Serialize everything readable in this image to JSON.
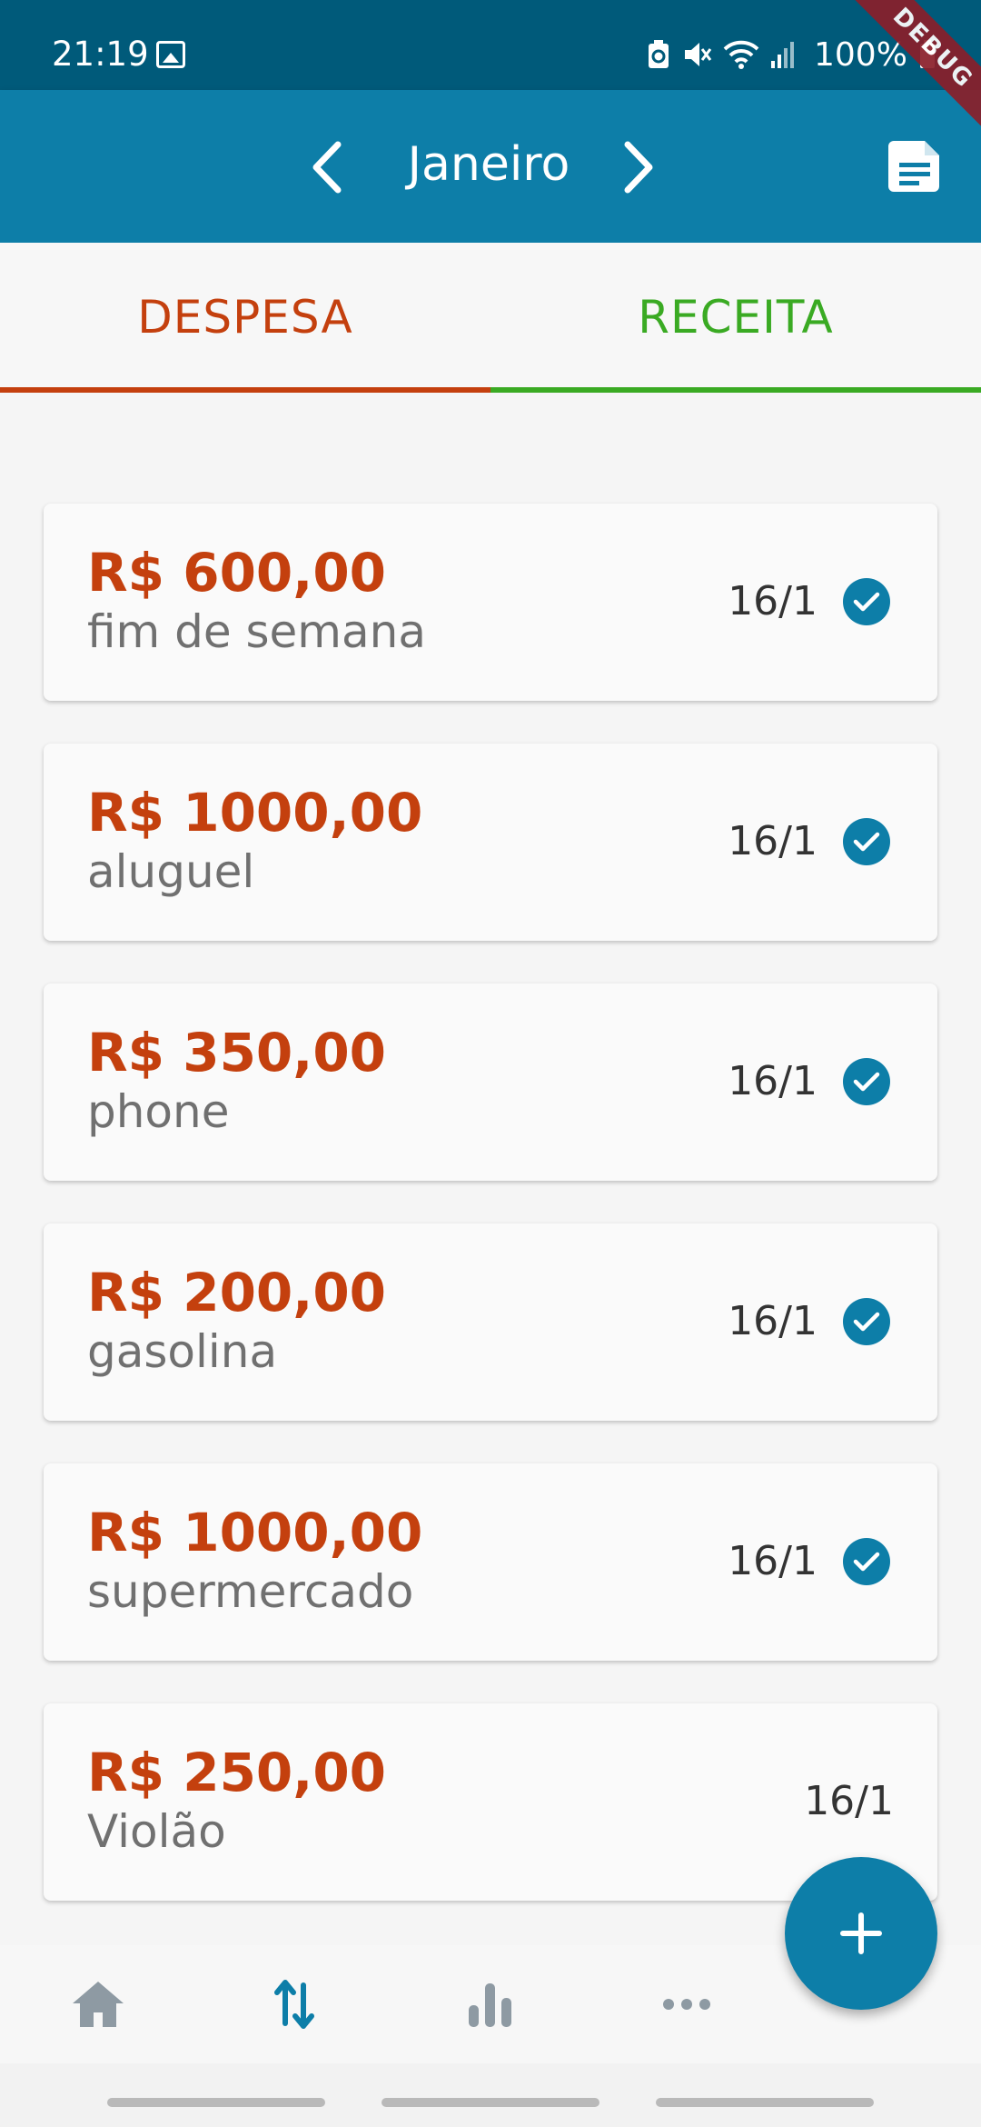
{
  "status_bar": {
    "time": "21:19",
    "battery_percent": "100%",
    "icons": [
      "gallery-icon",
      "battery-saver-icon",
      "mute-icon",
      "wifi-icon",
      "signal-icon",
      "battery-icon"
    ]
  },
  "debug_banner": "DEBUG",
  "header": {
    "month": "Janeiro",
    "prev_icon": "chevron-left-icon",
    "next_icon": "chevron-right-icon",
    "report_icon": "document-icon"
  },
  "tabs": [
    {
      "label": "DESPESA",
      "color": "#c4400e",
      "selected": true
    },
    {
      "label": "RECEITA",
      "color": "#3aaa23",
      "selected": false
    }
  ],
  "transactions": [
    {
      "amount": "R$ 600,00",
      "description": "fim de semana",
      "date": "16/1",
      "paid": true
    },
    {
      "amount": "R$ 1000,00",
      "description": "aluguel",
      "date": "16/1",
      "paid": true
    },
    {
      "amount": "R$ 350,00",
      "description": "phone",
      "date": "16/1",
      "paid": true
    },
    {
      "amount": "R$ 200,00",
      "description": "gasolina",
      "date": "16/1",
      "paid": true
    },
    {
      "amount": "R$ 1000,00",
      "description": "supermercado",
      "date": "16/1",
      "paid": true
    },
    {
      "amount": "R$ 250,00",
      "description": "Violão",
      "date": "16/1",
      "paid": false
    }
  ],
  "fab": {
    "icon": "plus-icon"
  },
  "bottom_nav": [
    {
      "icon": "home-icon",
      "active": false
    },
    {
      "icon": "transactions-icon",
      "active": true
    },
    {
      "icon": "bar-chart-icon",
      "active": false
    },
    {
      "icon": "more-icon",
      "active": false
    }
  ],
  "colors": {
    "primary": "#0d7ea8",
    "status_bar": "#005a7a",
    "expense": "#c4400e",
    "income": "#3aaa23",
    "inactive_icon": "#8e9aa3"
  }
}
